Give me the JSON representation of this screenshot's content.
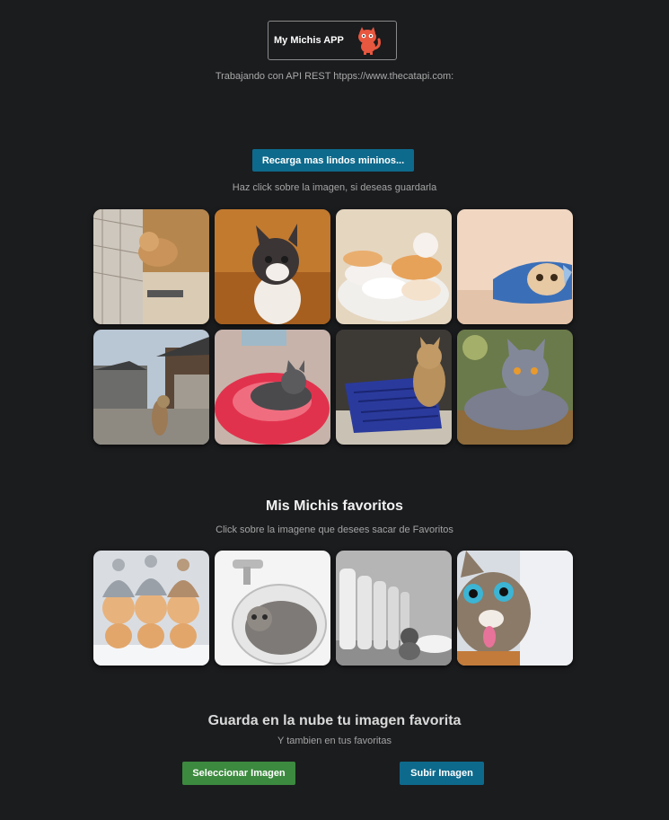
{
  "header": {
    "app_title": "My Michis APP",
    "logo_icon": "cat-logo-icon",
    "subtitle": "Trabajando con API REST htpps://www.thecatapi.com:"
  },
  "random": {
    "reload_label": "Recarga mas lindos mininos...",
    "hint": "Haz click sobre la imagen, si deseas guardarla",
    "images": [
      "cat-in-cardboard-box",
      "kitten-on-wood-floor",
      "sleeping-kittens-in-bowl",
      "cat-in-chip-bag",
      "cat-in-street-alley",
      "kitten-on-red-cushion",
      "cat-by-blue-basket",
      "gray-british-shorthair"
    ]
  },
  "favorites": {
    "title": "Mis Michis favoritos",
    "hint": "Click sobre la imagene que desees sacar de Favoritos",
    "images": [
      "three-kittens-in-knit-hats",
      "kitten-in-sink",
      "kitten-with-milk-bottles",
      "kitten-sticking-tongue-out"
    ]
  },
  "upload": {
    "title": "Guarda en la nube tu imagen favorita",
    "hint": "Y tambien en tus favoritas",
    "select_label": "Seleccionar Imagen",
    "upload_label": "Subir Imagen"
  },
  "colors": {
    "background": "#1b1c1e",
    "primary_button": "#0e6a8c",
    "select_button": "#3c8a3f",
    "logo_accent": "#e8573f"
  }
}
